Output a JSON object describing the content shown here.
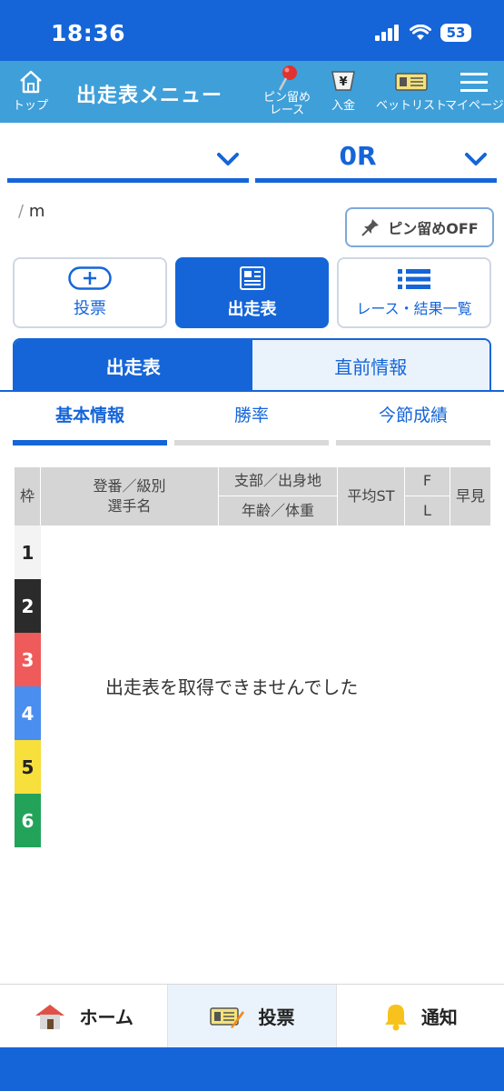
{
  "status": {
    "time": "18:36",
    "battery": "53"
  },
  "header": {
    "home_label": "トップ",
    "title": "出走表メニュー",
    "pin_label_1": "ピン留め",
    "pin_label_2": "レース",
    "deposit_label": "入金",
    "betlist_label": "ベットリスト",
    "mypage_label": "マイページ"
  },
  "selectors": {
    "venue_value": "",
    "race_value": "0R"
  },
  "race_info": {
    "slash": "/",
    "unit": "m"
  },
  "pin_toggle": {
    "label": "ピン留めOFF"
  },
  "actions": {
    "vote": "投票",
    "racecard": "出走表",
    "results": "レース・結果一覧"
  },
  "tabs": {
    "racecard": "出走表",
    "preinfo": "直前情報"
  },
  "subtabs": {
    "basic": "基本情報",
    "winrate": "勝率",
    "season": "今節成績"
  },
  "table": {
    "headers": {
      "waku": "枠",
      "reg_line1": "登番／級別",
      "reg_line2": "選手名",
      "branch": "支部／出身地",
      "age": "年齢／体重",
      "avg_st": "平均ST",
      "f": "F",
      "l": "L",
      "early": "早見"
    },
    "waku_numbers": [
      "1",
      "2",
      "3",
      "4",
      "5",
      "6"
    ],
    "waku_colors": [
      "#f3f3f3",
      "#2b2b2b",
      "#ef5a5a",
      "#4a8ef0",
      "#f7df3c",
      "#23a35a"
    ],
    "waku_text_colors": [
      "#222",
      "#fff",
      "#fff",
      "#fff",
      "#222",
      "#fff"
    ],
    "empty_message": "出走表を取得できませんでした"
  },
  "bottom_nav": {
    "home": "ホーム",
    "vote": "投票",
    "notice": "通知"
  }
}
